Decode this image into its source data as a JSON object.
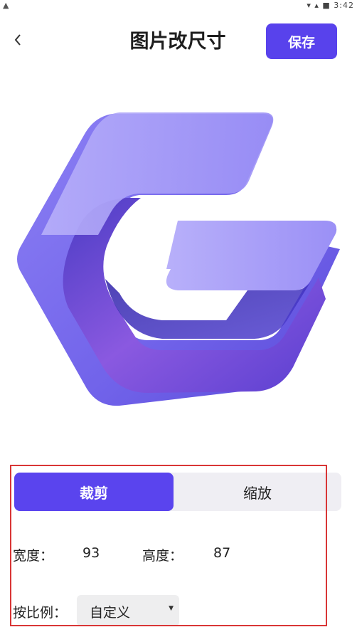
{
  "header": {
    "title": "图片改尺寸",
    "save_label": "保存"
  },
  "status_bar": {
    "right": "▾ ▴ ■ 3:42"
  },
  "tabs": [
    {
      "label": "裁剪",
      "active": true
    },
    {
      "label": "缩放",
      "active": false
    }
  ],
  "dimensions": {
    "width_label": "宽度：",
    "width_value": "93",
    "height_label": "高度：",
    "height_value": "87"
  },
  "ratio": {
    "label": "按比例：",
    "selected": "自定义"
  },
  "colors": {
    "accent": "#5842ec",
    "highlight_border": "#d93636",
    "logo_light": "#a79cf6",
    "logo_dark": "#4a36c4"
  },
  "icons": {
    "back": "chevron-left-icon",
    "dropdown": "caret-down-icon",
    "logo": "g-logo-icon"
  }
}
